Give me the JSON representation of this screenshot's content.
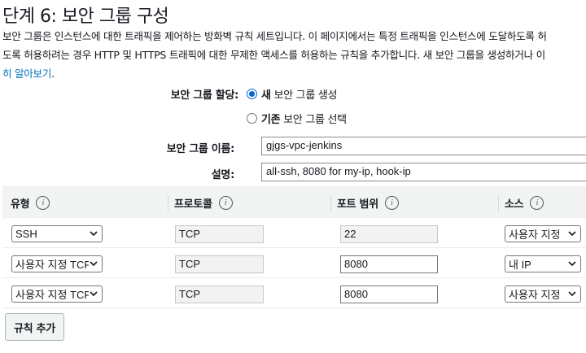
{
  "page": {
    "title": "단계 6: 보안 그룹 구성",
    "description_line1": "보안 그룹은 인스턴스에 대한 트래픽을 제어하는 방화벽 규칙 세트입니다. 이 페이지에서는 특정 트래픽을 인스턴스에 도달하도록 허",
    "description_line2": "도록 허용하려는 경우 HTTP 및 HTTPS 트래픽에 대한 무제한 액세스를 허용하는 규칙을 추가합니다. 새 보안 그룹을 생성하거나 이",
    "learn_more_link": "히 알아보기",
    "learn_more_suffix": "."
  },
  "assign": {
    "label": "보안 그룹 할당:",
    "option_new_bold": "새",
    "option_new_rest": "보안 그룹 생성",
    "option_existing_bold": "기존",
    "option_existing_rest": "보안 그룹 선택",
    "selected": "new"
  },
  "fields": {
    "name_label": "보안 그룹 이름:",
    "name_value": "gjgs-vpc-jenkins",
    "desc_label": "설명:",
    "desc_value": "all-ssh, 8080 for my-ip, hook-ip"
  },
  "table": {
    "headers": {
      "type": "유형",
      "protocol": "프로토콜",
      "port_range": "포트 범위",
      "source": "소스"
    },
    "rows": [
      {
        "type": "SSH",
        "protocol": "TCP",
        "port": "22",
        "port_disabled": true,
        "source": "사용자 지정"
      },
      {
        "type": "사용자 지정 TCP",
        "protocol": "TCP",
        "port": "8080",
        "port_disabled": false,
        "source": "내 IP"
      },
      {
        "type": "사용자 지정 TCP",
        "protocol": "TCP",
        "port": "8080",
        "port_disabled": false,
        "source": "사용자 지정"
      }
    ]
  },
  "buttons": {
    "add_rule": "규칙 추가"
  },
  "icons": {
    "info": "i"
  },
  "colors": {
    "link": "#0073bb",
    "radio_selected": "#0067d5",
    "header_bg": "#f2f3f3"
  }
}
